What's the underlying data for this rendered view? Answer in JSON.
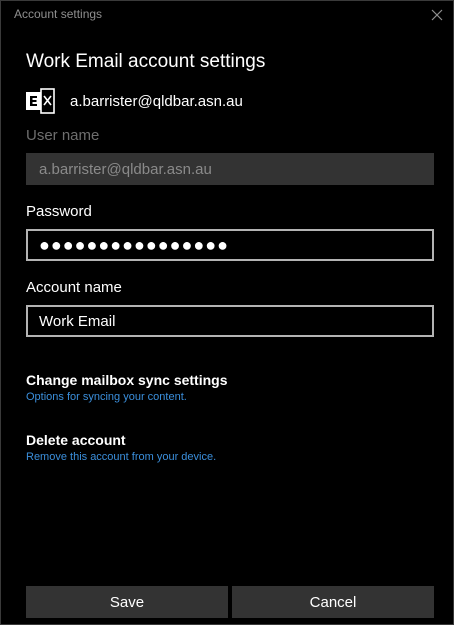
{
  "window": {
    "title": "Account settings",
    "close_icon": "close-icon"
  },
  "header": {
    "title": "Work Email account settings"
  },
  "account": {
    "icon": "exchange-icon",
    "email": "a.barrister@qldbar.asn.au"
  },
  "form": {
    "username": {
      "label": "User name",
      "value": "a.barrister@qldbar.asn.au"
    },
    "password": {
      "label": "Password",
      "value": "●●●●●●●●●●●●●●●●"
    },
    "account_name": {
      "label": "Account name",
      "value": "Work Email"
    }
  },
  "links": {
    "sync": {
      "title": "Change mailbox sync settings",
      "subtitle": "Options for syncing your content."
    },
    "delete": {
      "title": "Delete account",
      "subtitle": "Remove this account from your device."
    }
  },
  "buttons": {
    "save": "Save",
    "cancel": "Cancel"
  },
  "colors": {
    "background": "#000000",
    "accent_link": "#3b8fdc",
    "button_bg": "#333333",
    "disabled_field": "#333333"
  }
}
